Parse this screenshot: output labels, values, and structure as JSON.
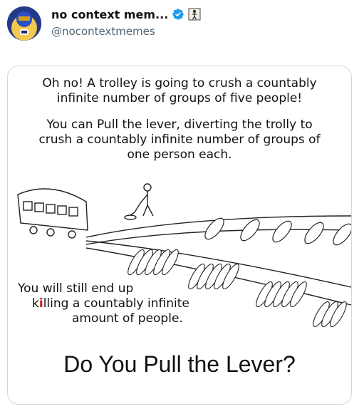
{
  "tweet": {
    "display_name": "no context mem...",
    "handle": "@nocontextmemes",
    "verified_icon": "verified-badge-icon",
    "extra_badge_icon": "figure-emoji-icon",
    "accent_color": "#1d9bf0"
  },
  "meme": {
    "line1": "Oh no! A trolley is going to crush a countably infinite number of groups of five people!",
    "line2": "You can Pull the lever, diverting the trolly to crush a countably infinite number of groups of one person each.",
    "still_part1": "You will still end up",
    "still_part2a": "k",
    "still_part2_red": "i",
    "still_part2b": "lling a countably infinite",
    "still_part3": "amount of people.",
    "question": "Do You Pull the Lever?"
  }
}
